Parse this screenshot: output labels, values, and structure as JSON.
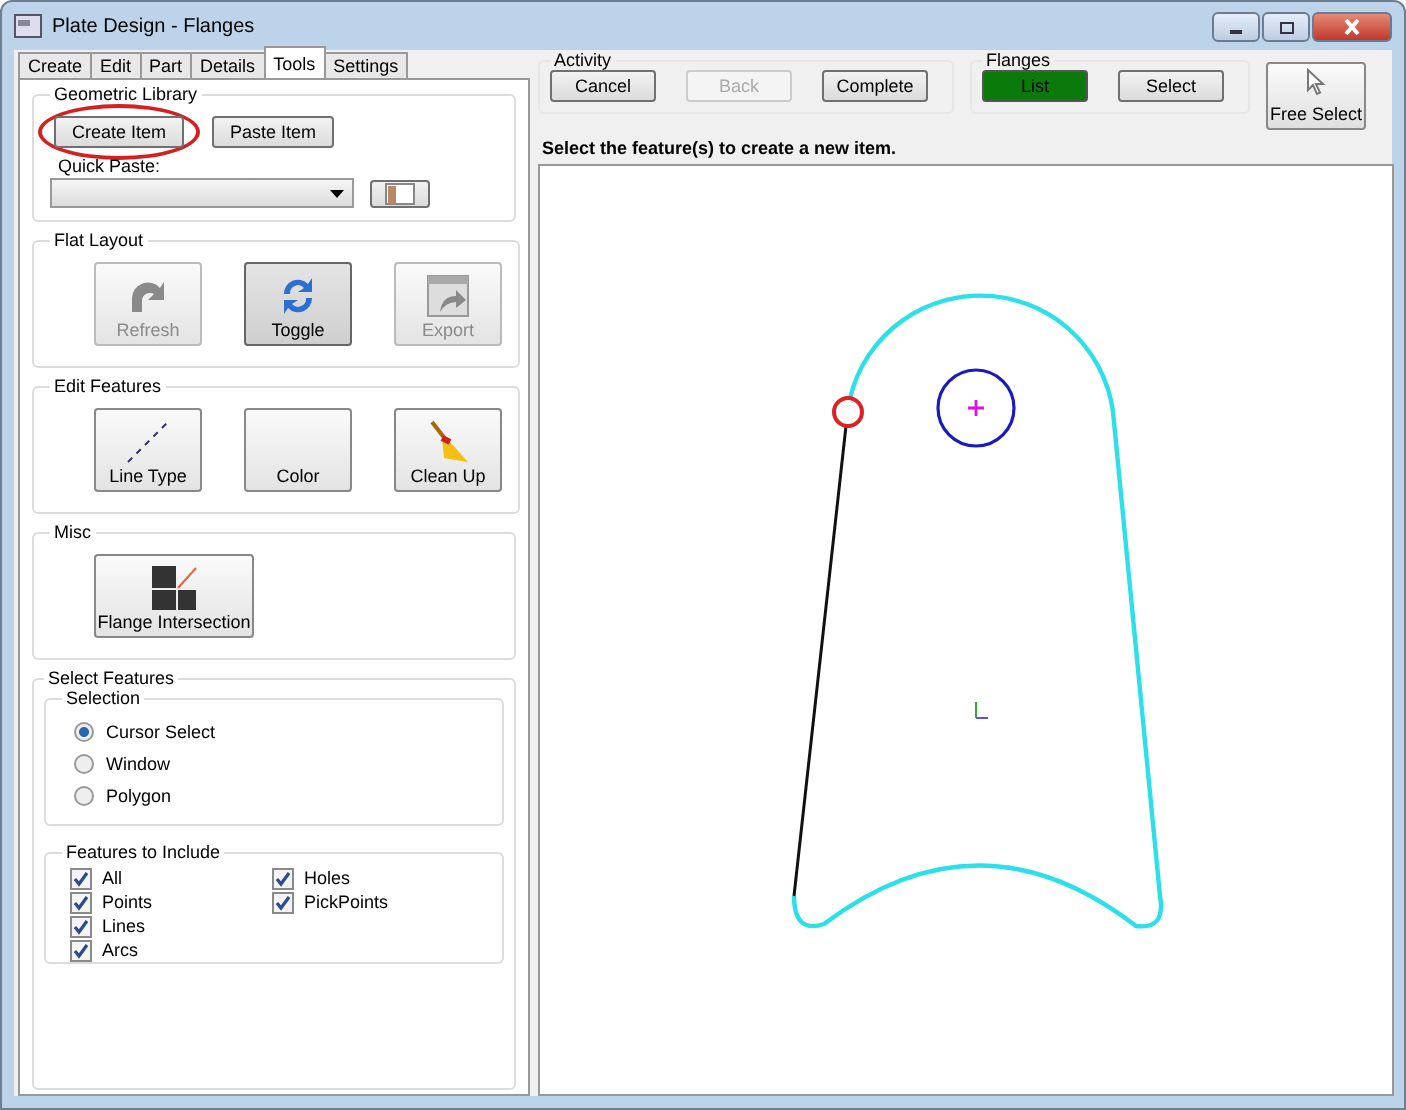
{
  "window": {
    "title": "Plate Design - Flanges"
  },
  "tabs": [
    {
      "label": "Create",
      "selected": false
    },
    {
      "label": "Edit",
      "selected": false
    },
    {
      "label": "Part",
      "selected": false
    },
    {
      "label": "Details",
      "selected": false
    },
    {
      "label": "Tools",
      "selected": true
    },
    {
      "label": "Settings",
      "selected": false
    }
  ],
  "geometric_library": {
    "title": "Geometric Library",
    "buttons": [
      {
        "label": "Create Item",
        "highlighted": true
      },
      {
        "label": "Paste Item",
        "highlighted": false
      }
    ],
    "quick_paste_label": "Quick Paste:"
  },
  "flat_layout": {
    "title": "Flat Layout",
    "buttons": [
      {
        "label": "Refresh",
        "disabled": true,
        "pressed": false
      },
      {
        "label": "Toggle",
        "disabled": false,
        "pressed": true
      },
      {
        "label": "Export",
        "disabled": true,
        "pressed": false
      }
    ]
  },
  "edit_features": {
    "title": "Edit Features",
    "buttons": [
      {
        "label": "Line Type"
      },
      {
        "label": "Color"
      },
      {
        "label": "Clean Up"
      }
    ]
  },
  "misc": {
    "title": "Misc",
    "buttons": [
      {
        "label": "Flange Intersection"
      }
    ]
  },
  "select_features": {
    "title": "Select Features",
    "selection_title": "Selection",
    "selection": [
      {
        "label": "Cursor Select",
        "selected": true
      },
      {
        "label": "Window",
        "selected": false
      },
      {
        "label": "Polygon",
        "selected": false
      }
    ],
    "include_title": "Features to Include",
    "include": [
      {
        "label": "All",
        "checked": true
      },
      {
        "label": "Holes",
        "checked": true
      },
      {
        "label": "Points",
        "checked": true
      },
      {
        "label": "PickPoints",
        "checked": true
      },
      {
        "label": "Lines",
        "checked": true
      },
      {
        "label": "Arcs",
        "checked": true
      }
    ]
  },
  "activity": {
    "title": "Activity",
    "buttons": [
      {
        "label": "Cancel",
        "disabled": false
      },
      {
        "label": "Back",
        "disabled": true
      },
      {
        "label": "Complete",
        "disabled": false
      }
    ]
  },
  "flanges": {
    "title": "Flanges",
    "buttons": [
      {
        "label": "List",
        "selected": true
      },
      {
        "label": "Select",
        "selected": false
      }
    ]
  },
  "free_select": {
    "label": "Free Select"
  },
  "instruction": "Select the feature(s) to create a new item."
}
